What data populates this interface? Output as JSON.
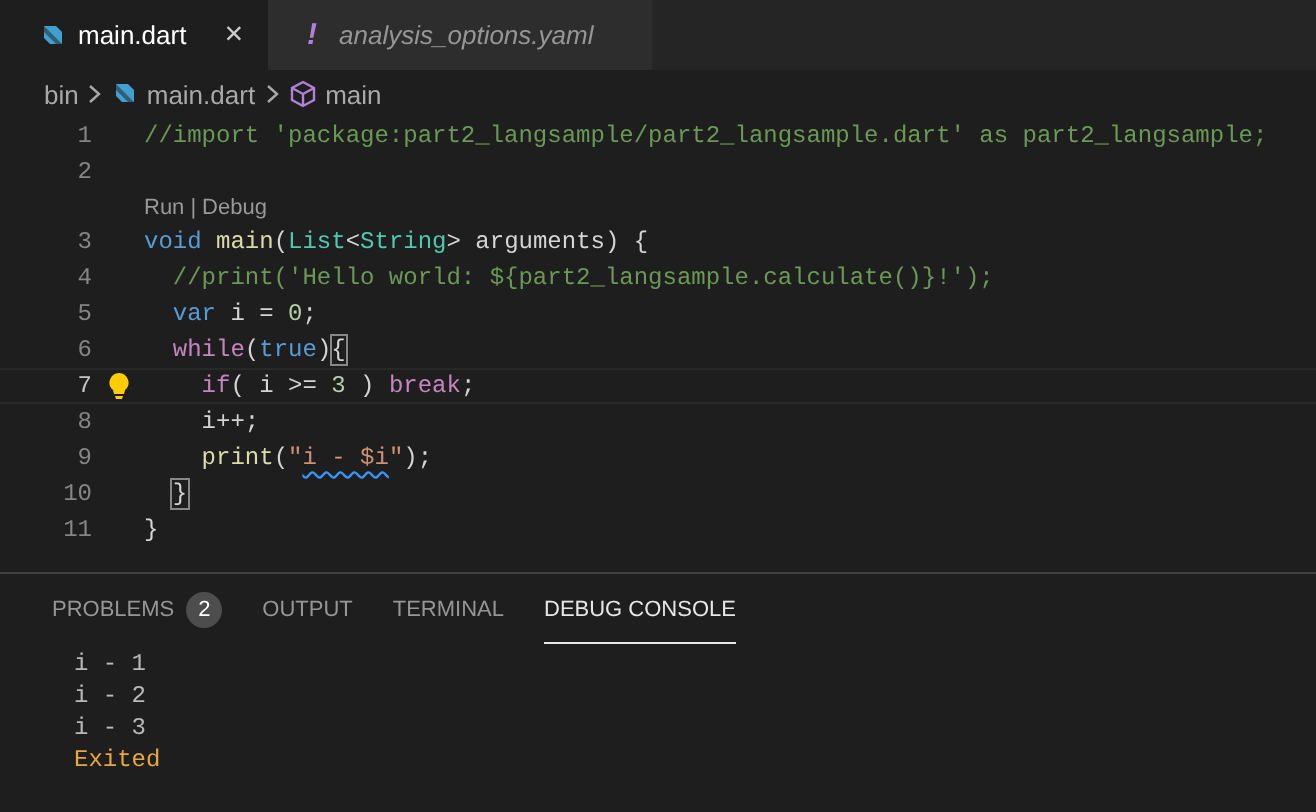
{
  "tabs": [
    {
      "label": "main.dart",
      "selected": true,
      "kind": "dart",
      "close": "×"
    },
    {
      "label": "analysis_options.yaml",
      "selected": false,
      "kind": "config",
      "glyph": "!"
    }
  ],
  "breadcrumb": [
    {
      "label": "bin",
      "kind": "folder"
    },
    {
      "label": "main.dart",
      "kind": "dart"
    },
    {
      "label": "main",
      "kind": "symbol"
    }
  ],
  "editor": {
    "lines": [
      {
        "number": "1",
        "tokens": [
          {
            "kind": "comment",
            "text": "//import 'package:part2_langsample/part2_langsample.dart' as part2_langsample;"
          }
        ]
      },
      {
        "number": "2"
      },
      {
        "number": "3",
        "codelens": {
          "links": [
            "Run",
            "Debug"
          ],
          "separator": "|"
        },
        "tokens": [
          {
            "kind": "keyword",
            "text": "void "
          },
          {
            "kind": "func",
            "text": "main"
          },
          {
            "kind": "plain",
            "text": "("
          },
          {
            "kind": "type",
            "text": "List"
          },
          {
            "kind": "plain",
            "text": "<"
          },
          {
            "kind": "type",
            "text": "String"
          },
          {
            "kind": "plain",
            "text": "> arguments) {"
          }
        ]
      },
      {
        "number": "4",
        "tokens": [
          {
            "kind": "comment",
            "text": "  //print('Hello world: ${part2_langsample.calculate()}!');"
          }
        ]
      },
      {
        "number": "5",
        "tokens": [
          {
            "kind": "keyword",
            "text": "  var"
          },
          {
            "kind": "plain",
            "text": " i = "
          },
          {
            "kind": "number",
            "text": "0"
          },
          {
            "kind": "plain",
            "text": ";"
          }
        ]
      },
      {
        "number": "6",
        "tokens": [
          {
            "kind": "control",
            "text": "  while"
          },
          {
            "kind": "plain",
            "text": "("
          },
          {
            "kind": "keyword",
            "text": "true"
          },
          {
            "kind": "plain",
            "text": ")"
          },
          {
            "kind": "plain",
            "text": "{",
            "matched": true
          }
        ]
      },
      {
        "number": "7",
        "current": true,
        "lightbulb": true,
        "tokens": [
          {
            "kind": "control",
            "text": "    if"
          },
          {
            "kind": "plain",
            "text": "( i >= "
          },
          {
            "kind": "number",
            "text": "3"
          },
          {
            "kind": "plain",
            "text": " ) "
          },
          {
            "kind": "control",
            "text": "break"
          },
          {
            "kind": "plain",
            "text": ";"
          }
        ]
      },
      {
        "number": "8",
        "tokens": [
          {
            "kind": "plain",
            "text": "    i++;"
          }
        ]
      },
      {
        "number": "9",
        "tokens": [
          {
            "kind": "func",
            "text": "    print"
          },
          {
            "kind": "plain",
            "text": "("
          },
          {
            "kind": "string",
            "text": "\""
          },
          {
            "kind": "string",
            "text": "i - $i",
            "squiggle": true
          },
          {
            "kind": "string",
            "text": "\""
          },
          {
            "kind": "plain",
            "text": ");"
          }
        ]
      },
      {
        "number": "10",
        "tokens": [
          {
            "kind": "plain",
            "text": "  }",
            "matched": true
          }
        ]
      },
      {
        "number": "11",
        "tokens": [
          {
            "kind": "plain",
            "text": "}"
          }
        ]
      }
    ]
  },
  "panel": {
    "tabs": [
      {
        "label": "PROBLEMS",
        "selected": false,
        "badge": "2"
      },
      {
        "label": "OUTPUT",
        "selected": false
      },
      {
        "label": "TERMINAL",
        "selected": false
      },
      {
        "label": "DEBUG CONSOLE",
        "selected": true
      }
    ],
    "console": [
      {
        "kind": "output",
        "text": "i - 1"
      },
      {
        "kind": "output",
        "text": "i - 2"
      },
      {
        "kind": "output",
        "text": "i - 3"
      },
      {
        "kind": "status",
        "text": "Exited"
      }
    ]
  }
}
